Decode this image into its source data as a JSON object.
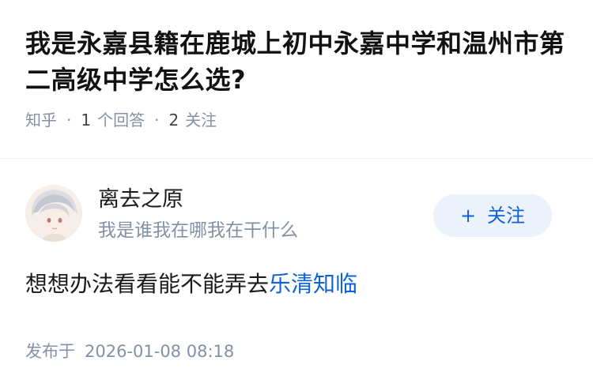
{
  "question": {
    "title": "我是永嘉县籍在鹿城上初中永嘉中学和温州市第二高级中学怎么选?",
    "source": "知乎",
    "answer_count": "1",
    "answer_label": "个回答",
    "follower_count": "2",
    "follower_label": "关注"
  },
  "answer": {
    "author": {
      "name": "离去之原",
      "bio": "我是谁我在哪我在干什么"
    },
    "follow_button": {
      "icon": "+",
      "label": "关注"
    },
    "content_text": "想想办法看看能不能弄去",
    "content_link": "乐清知临",
    "publish_label": "发布于",
    "publish_time": "2026-01-08 08:18"
  },
  "colors": {
    "accent": "#0d63d6",
    "follow_bg": "#ebf2fc",
    "meta_gray": "#8590a6"
  }
}
